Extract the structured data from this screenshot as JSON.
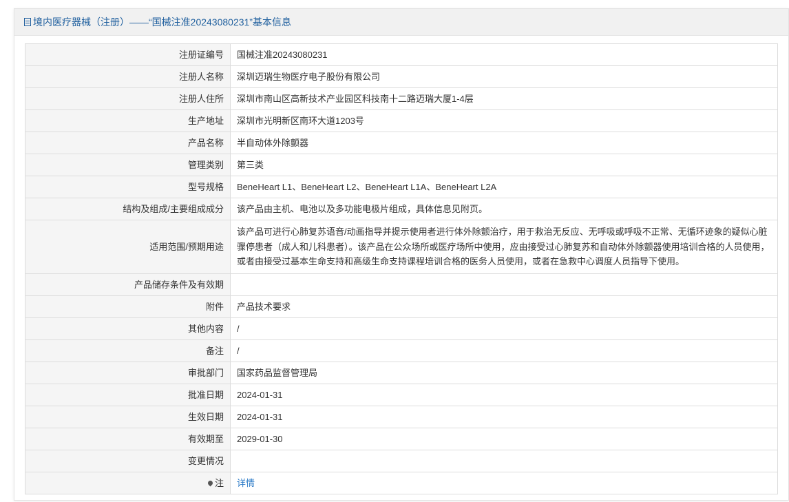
{
  "header": {
    "title": "境内医疗器械（注册）——“国械注准20243080231”基本信息"
  },
  "rows": [
    {
      "label": "注册证编号",
      "value": "国械注准20243080231"
    },
    {
      "label": "注册人名称",
      "value": "深圳迈瑞生物医疗电子股份有限公司"
    },
    {
      "label": "注册人住所",
      "value": "深圳市南山区高新技术产业园区科技南十二路迈瑞大厦1-4层"
    },
    {
      "label": "生产地址",
      "value": "深圳市光明新区南环大道1203号"
    },
    {
      "label": "产品名称",
      "value": "半自动体外除颤器"
    },
    {
      "label": "管理类别",
      "value": "第三类"
    },
    {
      "label": "型号规格",
      "value": "BeneHeart L1、BeneHeart L2、BeneHeart L1A、BeneHeart L2A"
    },
    {
      "label": "结构及组成/主要组成成分",
      "value": "该产品由主机、电池以及多功能电极片组成，具体信息见附页。"
    },
    {
      "label": "适用范围/预期用途",
      "value": "该产品可进行心肺复苏语音/动画指导并提示使用者进行体外除颤治疗，用于救治无反应、无呼吸或呼吸不正常、无循环迹象的疑似心脏骤停患者（成人和儿科患者）。该产品在公众场所或医疗场所中使用，应由接受过心肺复苏和自动体外除颤器使用培训合格的人员使用，或者由接受过基本生命支持和高级生命支持课程培训合格的医务人员使用，或者在急救中心调度人员指导下使用。"
    },
    {
      "label": "产品储存条件及有效期",
      "value": ""
    },
    {
      "label": "附件",
      "value": "产品技术要求"
    },
    {
      "label": "其他内容",
      "value": "/"
    },
    {
      "label": "备注",
      "value": "/"
    },
    {
      "label": "审批部门",
      "value": "国家药品监督管理局"
    },
    {
      "label": "批准日期",
      "value": "2024-01-31"
    },
    {
      "label": "生效日期",
      "value": "2024-01-31"
    },
    {
      "label": "有效期至",
      "value": "2029-01-30"
    },
    {
      "label": "变更情况",
      "value": ""
    },
    {
      "label": "注",
      "value": "详情"
    }
  ]
}
